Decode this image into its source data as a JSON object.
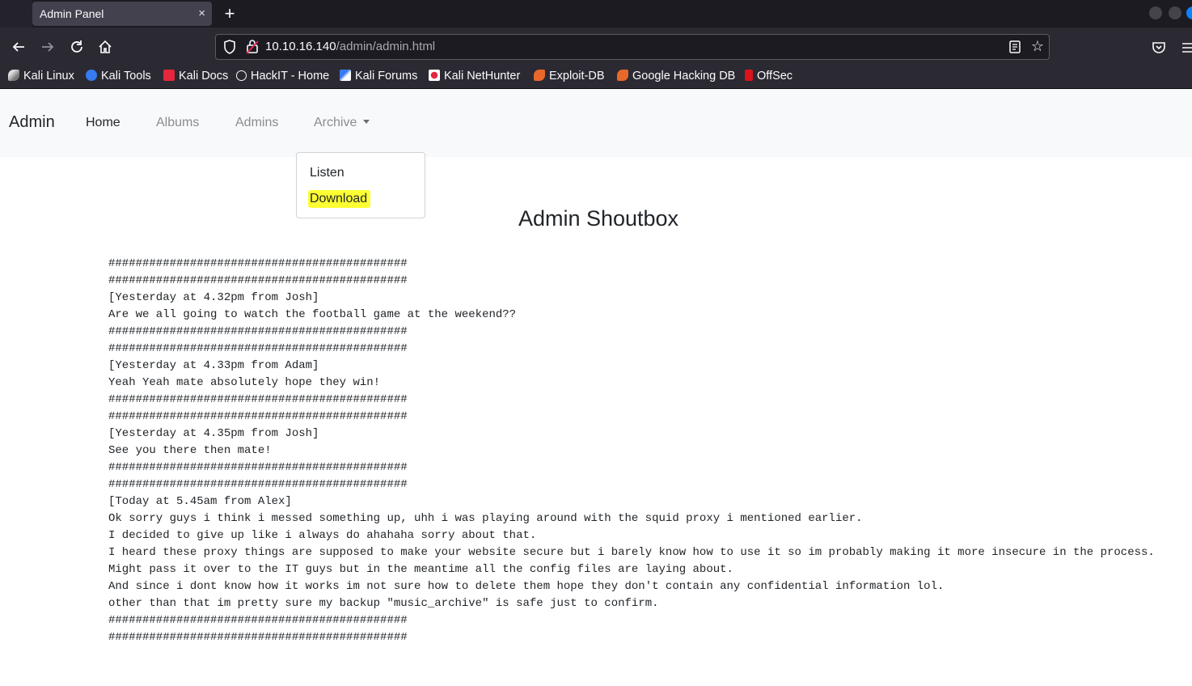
{
  "browser": {
    "tab_title": "Admin Panel",
    "tab_close": "×",
    "new_tab": "+",
    "url_host": "10.10.16.140",
    "url_path": "/admin/admin.html",
    "bookmarks": [
      {
        "label": "Kali Linux",
        "icon": "kali-dragon-icon"
      },
      {
        "label": "Kali Tools",
        "icon": "kali-tools-icon"
      },
      {
        "label": "Kali Docs",
        "icon": "kali-docs-icon"
      },
      {
        "label": "HackIT - Home",
        "icon": "globe-icon"
      },
      {
        "label": "Kali Forums",
        "icon": "kali-forums-icon"
      },
      {
        "label": "Kali NetHunter",
        "icon": "nethunter-icon"
      },
      {
        "label": "Exploit-DB",
        "icon": "exploit-db-icon"
      },
      {
        "label": "Google Hacking DB",
        "icon": "ghdb-icon"
      },
      {
        "label": "OffSec",
        "icon": "offsec-icon"
      }
    ]
  },
  "site_nav": {
    "brand": "Admin",
    "links": [
      "Home",
      "Albums",
      "Admins",
      "Archive"
    ]
  },
  "dropdown": {
    "items": [
      "Listen",
      "Download"
    ]
  },
  "shoutbox": {
    "title": "Admin Shoutbox",
    "lines": [
      "############################################",
      "############################################",
      "[Yesterday at 4.32pm from Josh]",
      "Are we all going to watch the football game at the weekend??",
      "############################################",
      "############################################",
      "[Yesterday at 4.33pm from Adam]",
      "Yeah Yeah mate absolutely hope they win!",
      "############################################",
      "############################################",
      "[Yesterday at 4.35pm from Josh]",
      "See you there then mate!",
      "############################################",
      "############################################",
      "[Today at 5.45am from Alex]",
      "Ok sorry guys i think i messed something up, uhh i was playing around with the squid proxy i mentioned earlier.",
      "I decided to give up like i always do ahahaha sorry about that.",
      "I heard these proxy things are supposed to make your website secure but i barely know how to use it so im probably making it more insecure in the process.",
      "Might pass it over to the IT guys but in the meantime all the config files are laying about.",
      "And since i dont know how it works im not sure how to delete them hope they don't contain any confidential information lol.",
      "other than that im pretty sure my backup \"music_archive\" is safe just to confirm.",
      "############################################",
      "############################################"
    ]
  },
  "colors": {
    "highlight": "#fdff32",
    "chrome_dark": "#1c1b22",
    "chrome": "#2b2a33",
    "navbar_bg": "#f8f9fa"
  }
}
